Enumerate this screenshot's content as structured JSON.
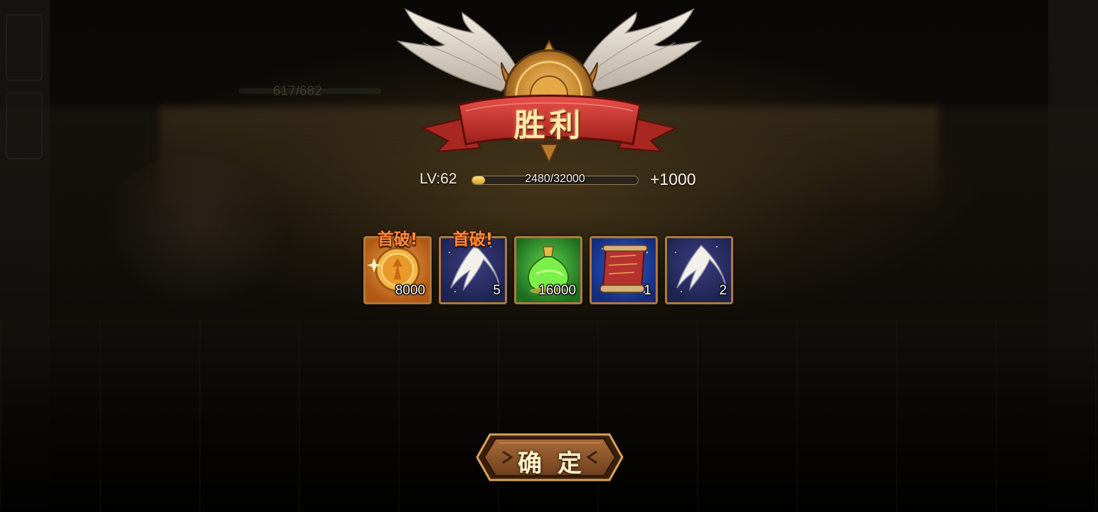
{
  "result": {
    "title": "胜利"
  },
  "level": {
    "label": "LV:62",
    "xp_text": "2480/32000",
    "xp_current": 2480,
    "xp_max": 32000,
    "xp_gain": "+1000"
  },
  "background": {
    "hp_text": "617/682"
  },
  "rewards": [
    {
      "icon": "gold-coin-icon",
      "count": "8000",
      "first_clear": "首破!",
      "bg": "orange"
    },
    {
      "icon": "angel-feather-icon",
      "count": "5",
      "first_clear": "首破!",
      "bg": "night"
    },
    {
      "icon": "green-potion-icon",
      "count": "16000",
      "first_clear": "",
      "bg": "green"
    },
    {
      "icon": "scroll-icon",
      "count": "1",
      "first_clear": "",
      "bg": "blue"
    },
    {
      "icon": "angel-feather-icon",
      "count": "2",
      "first_clear": "",
      "bg": "night"
    }
  ],
  "confirm_button": {
    "label": "确定"
  },
  "colors": {
    "accent_gold": "#d9a023",
    "ribbon_red": "#c8342b",
    "first_clear_orange": "#ff8a3a"
  }
}
